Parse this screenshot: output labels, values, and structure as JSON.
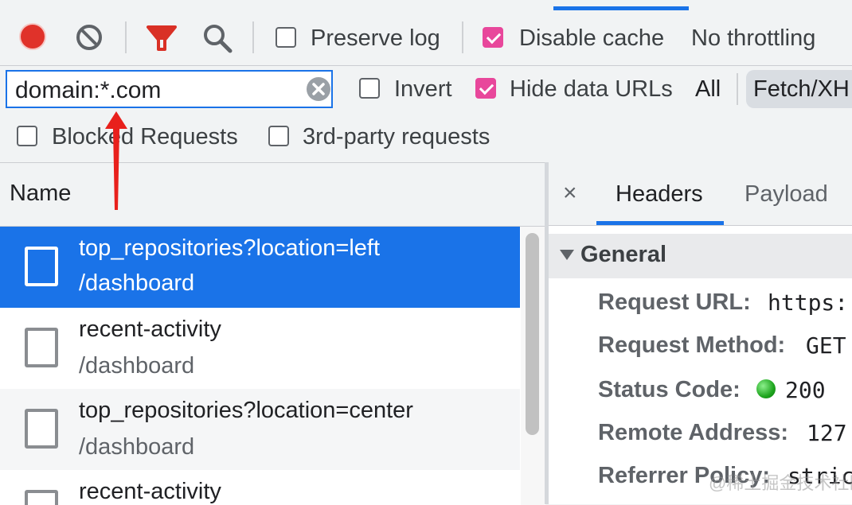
{
  "toolbar": {
    "preserve_log_label": "Preserve log",
    "preserve_log_checked": false,
    "disable_cache_label": "Disable cache",
    "disable_cache_checked": true,
    "throttling_label": "No throttling"
  },
  "filter_bar": {
    "filter_value": "domain:*.com",
    "invert_label": "Invert",
    "invert_checked": false,
    "hide_data_urls_label": "Hide data URLs",
    "hide_data_urls_checked": true,
    "type_all_label": "All",
    "type_fetch_label": "Fetch/XH",
    "blocked_requests_label": "Blocked Requests",
    "third_party_label": "3rd-party requests"
  },
  "requests": {
    "column_name_label": "Name",
    "rows": [
      {
        "name": "top_repositories?location=left",
        "path": "/dashboard",
        "selected": true
      },
      {
        "name": "recent-activity",
        "path": "/dashboard",
        "selected": false
      },
      {
        "name": "top_repositories?location=center",
        "path": "/dashboard",
        "selected": false
      },
      {
        "name": "recent-activity",
        "path": "",
        "selected": false
      }
    ]
  },
  "details": {
    "close_label": "×",
    "tabs": [
      "Headers",
      "Payload"
    ],
    "active_tab": "Headers",
    "section_title": "General",
    "fields": [
      {
        "key": "Request URL:",
        "value": "https:"
      },
      {
        "key": "Request Method:",
        "value": "GET"
      },
      {
        "key": "Status Code:",
        "value": "200"
      },
      {
        "key": "Remote Address:",
        "value": "127"
      },
      {
        "key": "Referrer Policy:",
        "value": "stric"
      }
    ]
  },
  "watermark": "@稀土掘金技术社区",
  "colors": {
    "accent": "#1a73e8",
    "checkbox_checked": "#e8479b",
    "record": "#e0322a",
    "filter_icon": "#d93025",
    "annotation_arrow": "#e8201c",
    "status_ok": "#1fa51f"
  }
}
